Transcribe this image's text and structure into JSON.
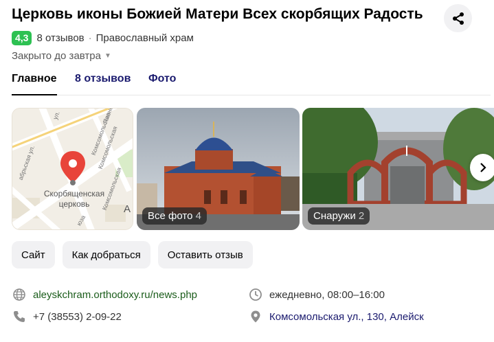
{
  "header": {
    "title": "Церковь иконы Божией Матери Всех скорбящих Радость",
    "rating": "4,3",
    "reviews": "8 отзывов",
    "separator": "·",
    "category": "Православный храм",
    "hours_status": "Закрыто до завтра"
  },
  "tabs": [
    {
      "label": "Главное"
    },
    {
      "label": "8 отзывов"
    },
    {
      "label": "Фото"
    }
  ],
  "gallery": {
    "map_place_label": "Скорбященская церковь",
    "map_street_labels": [
      "ул.",
      "Пионе",
      "Комсомольская",
      "Комсомольская",
      "Комсомольская",
      "абрьская ул.",
      "юза",
      "А"
    ],
    "photos": [
      {
        "label": "Все фото",
        "count": "4"
      },
      {
        "label": "Снаружи",
        "count": "2"
      }
    ]
  },
  "actions": [
    {
      "label": "Сайт"
    },
    {
      "label": "Как добраться"
    },
    {
      "label": "Оставить отзыв"
    }
  ],
  "info": {
    "website": "aleyskchram.orthodoxy.ru/news.php",
    "phone": "+7 (38553) 2-09-22",
    "hours": "ежедневно, 08:00–16:00",
    "address": "Комсомольская ул., 130, Алейск"
  },
  "colors": {
    "rating_green": "#2dc152",
    "pin_red": "#e8443a",
    "tab_blue": "#1a1a6e",
    "link_green": "#1a5c1a"
  }
}
